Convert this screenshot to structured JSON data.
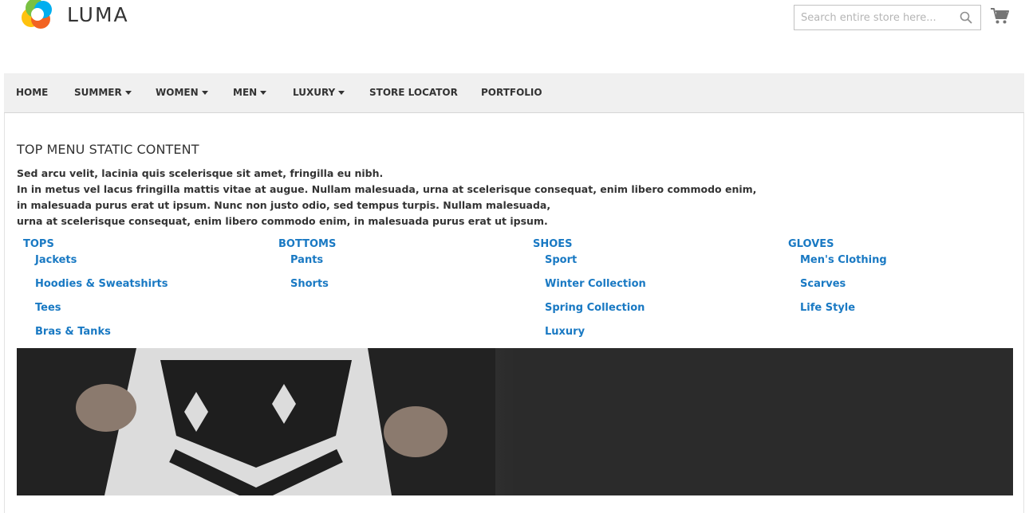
{
  "brand": {
    "name": "LUMA",
    "logo_icon": "luma-logo-icon"
  },
  "header": {
    "search": {
      "placeholder": "Search entire store here...",
      "value": "",
      "icon": "search-icon"
    },
    "cart": {
      "icon": "cart-icon"
    }
  },
  "nav": {
    "items": [
      {
        "label": "HOME",
        "has_dropdown": false
      },
      {
        "label": "SUMMER",
        "has_dropdown": true
      },
      {
        "label": "WOMEN",
        "has_dropdown": true
      },
      {
        "label": "MEN",
        "has_dropdown": true
      },
      {
        "label": "LUXURY",
        "has_dropdown": true
      },
      {
        "label": "STORE LOCATOR",
        "has_dropdown": false
      },
      {
        "label": "PORTFOLIO",
        "has_dropdown": false
      }
    ]
  },
  "menu_panel": {
    "title": "TOP MENU STATIC CONTENT",
    "description": [
      "Sed arcu velit, lacinia quis scelerisque sit amet, fringilla eu nibh.",
      "In in metus vel lacus fringilla mattis vitae at augue. Nullam malesuada, urna at scelerisque consequat, enim libero commodo enim,",
      "in malesuada purus erat ut ipsum. Nunc non justo odio, sed tempus turpis. Nullam malesuada,",
      "urna at scelerisque consequat, enim libero commodo enim, in malesuada purus erat ut ipsum."
    ],
    "columns": [
      {
        "heading": "TOPS",
        "links": [
          "Jackets",
          "Hoodies & Sweatshirts",
          "Tees",
          "Bras & Tanks"
        ]
      },
      {
        "heading": "BOTTOMS",
        "links": [
          "Pants",
          "Shorts"
        ]
      },
      {
        "heading": "SHOES",
        "links": [
          "Sport",
          "Winter Collection",
          "Spring Collection",
          "Luxury"
        ]
      },
      {
        "heading": "GLOVES",
        "links": [
          "Men's Clothing",
          "Scarves",
          "Life Style"
        ]
      }
    ],
    "banner": {
      "description": "promo-banner-image"
    }
  },
  "colors": {
    "link": "#1979c3",
    "text": "#333333",
    "nav_bg": "#f0f0f0",
    "banner_bg": "#2b2b2b",
    "logo": [
      "#f26322",
      "#7ac142",
      "#00aeef",
      "#ffc20e"
    ]
  }
}
